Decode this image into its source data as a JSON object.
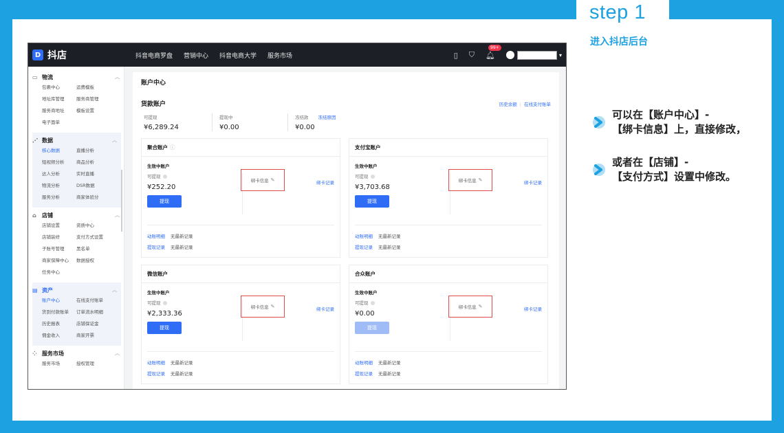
{
  "slide": {
    "step_title": "step 1",
    "step_subtitle": "进入抖店后台",
    "notes": [
      {
        "line1": "可以在【账户中心】-",
        "line2": "【绑卡信息】上，直接修改，"
      },
      {
        "line1": "或者在【店铺】-",
        "line2": "【支付方式】设置中修改。"
      }
    ],
    "colors": {
      "accent": "#1da1e0",
      "highlight_box": "#e04b4b",
      "primary_blue": "#2f6df6",
      "appbar": "#1c1f26"
    }
  },
  "app": {
    "logo_text": "抖店",
    "logo_mark": "D",
    "nav": [
      "抖音电商罗盘",
      "营销中心",
      "抖音电商大学",
      "服务市场"
    ],
    "badge": "99+",
    "icons": [
      "phone-icon",
      "cart-icon",
      "bell-icon",
      "user-icon"
    ]
  },
  "sidebar": {
    "groups": [
      {
        "title": "物流",
        "icon": "▭",
        "items": [
          "包裹中心",
          "运费模板",
          "地址库管理",
          "服务商管理",
          "服务商地址",
          "模板设置",
          "电子面单",
          ""
        ]
      },
      {
        "title": "数据",
        "icon": "⋰",
        "items": [
          "核心数据",
          "直播分析",
          "短视频分析",
          "商品分析",
          "达人分析",
          "实时直播",
          "物流分析",
          "DSR数据",
          "服务分析",
          "商家体验分"
        ]
      },
      {
        "title": "店铺",
        "icon": "⌂",
        "items": [
          "店铺设置",
          "资质中心",
          "店铺装修",
          "支付方式设置",
          "子账号管理",
          "黑名单",
          "商家保障中心",
          "数据授权",
          "任务中心",
          ""
        ]
      },
      {
        "title": "资产",
        "icon": "▤",
        "items": [
          "账户中心",
          "在线支付账单",
          "货到付款账单",
          "订单流水明细",
          "历史报表",
          "店铺保证金",
          "佣金收入",
          "商家开票"
        ]
      },
      {
        "title": "服务市场",
        "icon": "⁘",
        "items": [
          "服务市场",
          "授权管理"
        ]
      }
    ]
  },
  "main": {
    "page_title": "账户中心",
    "goods_account": {
      "title": "货款账户",
      "link_history": "历史余额",
      "link_bill": "在线支付账单",
      "balances": [
        {
          "label": "可提现",
          "value": "¥6,289.24",
          "extra": ""
        },
        {
          "label": "提现中",
          "value": "¥0.00",
          "extra": ""
        },
        {
          "label": "冻结款",
          "value": "¥0.00",
          "extra": "冻结原因"
        }
      ]
    },
    "cards": [
      {
        "title": "聚合账户",
        "has_help": "true",
        "status": "生效中账户",
        "sub": "可提现",
        "amount": "¥252.20",
        "button": "提现",
        "bind": "绑卡信息",
        "bind_record": "绑卡记录",
        "flow": "动账明细",
        "flow_note": "无最新记录",
        "withdraw_rec": "提现记录",
        "withdraw_note": "无最新记录"
      },
      {
        "title": "支付宝账户",
        "has_help": "",
        "status": "生效中账户",
        "sub": "可提现",
        "amount": "¥3,703.68",
        "button": "提现",
        "bind": "绑卡信息",
        "bind_record": "绑卡记录",
        "flow": "动账明细",
        "flow_note": "无最新记录",
        "withdraw_rec": "提现记录",
        "withdraw_note": "无最新记录"
      },
      {
        "title": "微信账户",
        "has_help": "",
        "status": "生效中账户",
        "sub": "可提现",
        "amount": "¥2,333.36",
        "button": "提现",
        "bind": "绑卡信息",
        "bind_record": "绑卡记录",
        "flow": "动账明细",
        "flow_note": "无最新记录",
        "withdraw_rec": "提现记录",
        "withdraw_note": "无最新记录"
      },
      {
        "title": "合众账户",
        "has_help": "",
        "status": "生效中账户",
        "sub": "可提现",
        "amount": "¥0.00",
        "button": "提现",
        "bind": "绑卡信息",
        "bind_record": "绑卡记录",
        "flow": "动账明细",
        "flow_note": "无最新记录",
        "withdraw_rec": "提现记录",
        "withdraw_note": "无最新记录"
      }
    ]
  }
}
